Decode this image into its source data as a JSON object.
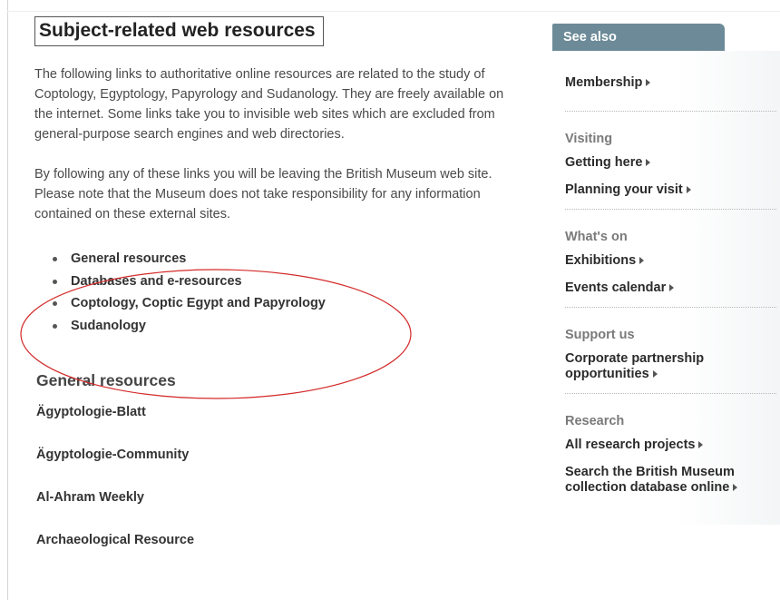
{
  "page": {
    "title": "Subject-related web resources",
    "intro_paragraph_1": "The following links to authoritative online resources are related to the study of Coptology, Egyptology, Papyrology and Sudanology. They are freely available on the internet. Some links take you to invisible web sites which are excluded from general-purpose search engines and web directories.",
    "intro_paragraph_2": "By following any of these links you will be leaving the British Museum web site. Please note that the Museum does not take responsibility for any information contained on these external sites.",
    "toc": [
      "General resources",
      "Databases and e-resources",
      "Coptology, Coptic Egypt and Papyrology",
      "Sudanology"
    ],
    "section_heading": "General resources",
    "resources": [
      "Ägyptologie-Blatt",
      "Ägyptologie-Community",
      "Al-Ahram Weekly",
      "Archaeological Resource"
    ]
  },
  "sidebar": {
    "tab_label": "See also",
    "membership": "Membership",
    "groups": [
      {
        "heading": "Visiting",
        "links": [
          "Getting here",
          "Planning your visit"
        ]
      },
      {
        "heading": "What's on",
        "links": [
          "Exhibitions",
          "Events calendar"
        ]
      },
      {
        "heading": "Support us",
        "links": [
          "Corporate partnership opportunities"
        ]
      },
      {
        "heading": "Research",
        "links": [
          "All research projects",
          "Search the British Museum collection database online"
        ]
      }
    ]
  },
  "colors": {
    "tab_background": "#6c8a97",
    "annotation_ellipse": "#d42a2a",
    "link_text": "#2b2b2b",
    "muted_heading": "#7a7a7a"
  }
}
